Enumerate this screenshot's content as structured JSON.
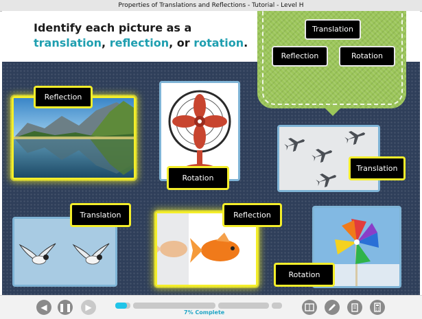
{
  "window": {
    "title": "Properties of Translations and Reflections - Tutorial - Level H"
  },
  "prompt": {
    "line1": "Identify each picture as a",
    "word1": "translation",
    "sep1": ", ",
    "word2": "reflection",
    "sep2": ", or ",
    "word3": "rotation",
    "end": "."
  },
  "word_bank": {
    "chips": [
      "Translation",
      "Reflection",
      "Rotation"
    ]
  },
  "pictures": [
    {
      "name": "lake-mountain-picture",
      "answer": "Reflection"
    },
    {
      "name": "fan-picture",
      "answer": "Rotation"
    },
    {
      "name": "jets-picture",
      "answer": "Translation"
    },
    {
      "name": "gulls-picture",
      "answer": "Translation"
    },
    {
      "name": "goldfish-picture",
      "answer": "Reflection"
    },
    {
      "name": "pinwheel-picture",
      "answer": "Rotation"
    }
  ],
  "footer": {
    "progress_label": "7% Complete",
    "progress": 0.07,
    "back_icon": "arrow-left-icon",
    "pause_icon": "pause-icon",
    "next_icon": "arrow-right-icon",
    "tools": [
      "glossary-icon",
      "pencil-icon",
      "notepad-icon",
      "calculator-icon"
    ]
  },
  "colors": {
    "accent_teal": "#1f9fb0",
    "highlight_yellow": "#f4ee2a",
    "progress_cyan": "#21c4e8",
    "bank_green": "#9cc65a"
  }
}
